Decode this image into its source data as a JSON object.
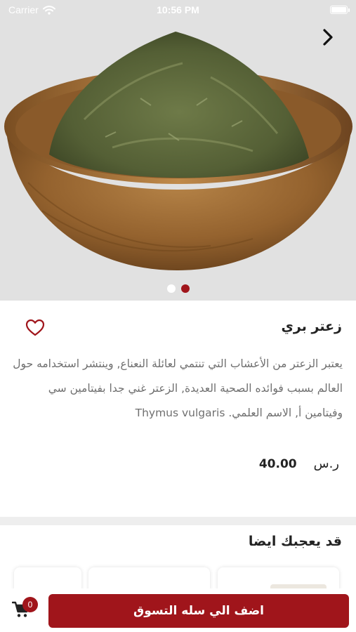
{
  "status_bar": {
    "carrier": "Carrier",
    "time": "10:56 PM"
  },
  "hero": {
    "image_alt": "wild thyme in a wooden bowl",
    "dots_total": 2,
    "active_dot": 1
  },
  "product": {
    "title": "زعتر بري",
    "description": "يعتبر الزعتر من الأعشاب التي تنتمي لعائلة النعناع, وينتشر استخدامه حول العالم بسبب فوائده الصحية العديدة, الزعتر غني جدا بفيتامين سي وفيتامين أ, الاسم العلمي. Thymus vulgaris",
    "price": "40.00",
    "currency": "ر.س"
  },
  "related": {
    "title": "قد يعجبك ايضا"
  },
  "cart": {
    "count": "0",
    "add_label": "اضف الي سله التسوق"
  },
  "colors": {
    "accent": "#a0151b",
    "hero_bg": "#e1e1e1",
    "text_muted": "#6f6f6f"
  },
  "icons": [
    "wifi-icon",
    "battery-icon",
    "chevron-right-icon",
    "heart-icon",
    "cart-icon"
  ]
}
